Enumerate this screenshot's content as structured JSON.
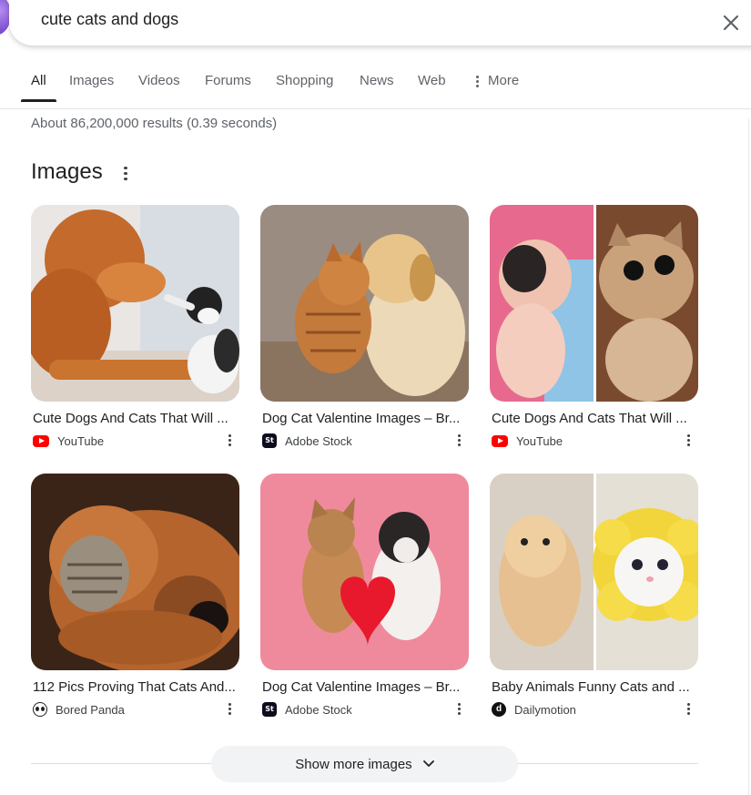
{
  "search": {
    "query": "cute cats and dogs",
    "clear_icon": "close-icon"
  },
  "tabs": [
    {
      "label": "All",
      "active": true
    },
    {
      "label": "Images",
      "active": false
    },
    {
      "label": "Videos",
      "active": false
    },
    {
      "label": "Forums",
      "active": false
    },
    {
      "label": "Shopping",
      "active": false
    },
    {
      "label": "News",
      "active": false
    },
    {
      "label": "Web",
      "active": false
    },
    {
      "label": "More",
      "active": false
    }
  ],
  "results_stats": "About 86,200,000 results (0.39 seconds)",
  "images_section": {
    "title": "Images",
    "cards": [
      {
        "title": "Cute Dogs And Cats That Will ...",
        "source": "YouTube",
        "source_icon": "youtube-icon"
      },
      {
        "title": "Dog Cat Valentine Images – Br...",
        "source": "Adobe Stock",
        "source_icon": "adobe-stock-icon"
      },
      {
        "title": "Cute Dogs And Cats That Will ...",
        "source": "YouTube",
        "source_icon": "youtube-icon"
      },
      {
        "title": "112 Pics Proving That Cats And...",
        "source": "Bored Panda",
        "source_icon": "bored-panda-icon"
      },
      {
        "title": "Dog Cat Valentine Images – Br...",
        "source": "Adobe Stock",
        "source_icon": "adobe-stock-icon"
      },
      {
        "title": "Baby Animals Funny Cats and ...",
        "source": "Dailymotion",
        "source_icon": "dailymotion-icon"
      }
    ],
    "show_more_label": "Show more images"
  },
  "colors": {
    "youtube_red": "#ff0000",
    "text_primary": "#202124",
    "text_secondary": "#5f6368",
    "chip_bg": "#f1f3f4"
  }
}
